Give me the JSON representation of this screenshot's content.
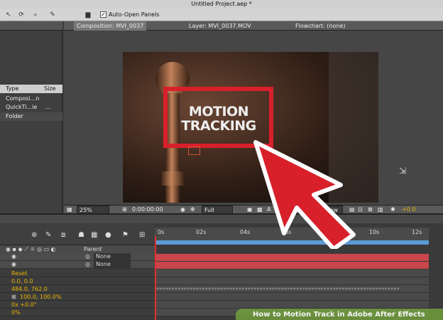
{
  "window": {
    "title": "Untitled Project.aep *"
  },
  "toolbar": {
    "auto_open_panels_label": "Auto-Open Panels",
    "auto_open_checked": true
  },
  "project_panel": {
    "columns": {
      "type": "Type",
      "size": "Size"
    },
    "rows": [
      {
        "type": "Composi...n"
      },
      {
        "type": "QuickTi...ie",
        "size": "..."
      },
      {
        "type": "Folder"
      }
    ]
  },
  "comp_panel": {
    "tabs": [
      {
        "label": "Composition: MVI_0037"
      },
      {
        "label": "Layer: MVI_0037.MOV"
      },
      {
        "label": "Flowchart: (none)"
      }
    ],
    "video_text_line1": "MOTION",
    "video_text_line2": "TRACKING",
    "bottom_bar": {
      "zoom": "25%",
      "timecode": "0:00:00:00",
      "resolution": "Full",
      "view_prefix": "A",
      "view": "View",
      "exposure": "+0.0"
    }
  },
  "timeline": {
    "parent_header": "Parent",
    "ruler_ticks": [
      "0s",
      "02s",
      "04s",
      "06s",
      "10s",
      "12s"
    ],
    "layers": [
      {
        "parent": "None"
      },
      {
        "parent": "None"
      }
    ],
    "properties": [
      {
        "value": "Reset"
      },
      {
        "value": "0.0, 0.0"
      },
      {
        "value": "484.0, 762.0"
      },
      {
        "value": "100.0, 100.0%"
      },
      {
        "value": "0x +0.0°"
      },
      {
        "value": "0%"
      }
    ],
    "keyframe_pattern": "»»»»»»»»»»»»»»»»»»»»»»»»»»»»»»»»»»»»»»»»»»»»»»»»»»»»»»»»»»»»»»»»»»»»»»»»»»»»»»»»"
  },
  "watermark": {
    "text": "How to Motion Track in Adobe After Effects"
  },
  "colors": {
    "track_red": "#d8202a",
    "layer_bar": "#c8464c",
    "property_yellow": "#e8b400",
    "watermark_green": "#78aa3c"
  },
  "icons": [
    "selection-tool-icon",
    "hand-tool-icon",
    "zoom-tool-icon",
    "pen-tool-icon",
    "folder-icon",
    "cursor-icon",
    "arrow-annotation-icon"
  ]
}
